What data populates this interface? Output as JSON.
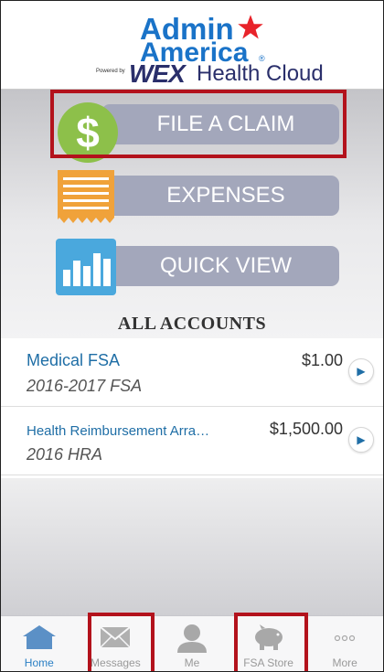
{
  "logo": {
    "line1": "Admin",
    "line2": "America",
    "registered": "®",
    "powered_by": "Powered by",
    "brand": "WEX",
    "brand_suffix": "Health Cloud",
    "star_color": "#e8232a"
  },
  "actions": [
    {
      "label": "FILE A CLAIM",
      "icon": "dollar-icon",
      "glyph": "$"
    },
    {
      "label": "EXPENSES",
      "icon": "receipt-icon"
    },
    {
      "label": "QUICK VIEW",
      "icon": "bar-chart-icon"
    }
  ],
  "section_title": "ALL ACCOUNTS",
  "accounts": [
    {
      "name": "Medical FSA",
      "amount": "$1.00",
      "plan": "2016-2017 FSA"
    },
    {
      "name": "Health Reimbursement Arra…",
      "amount": "$1,500.00",
      "plan": "2016 HRA"
    }
  ],
  "tabs": [
    {
      "label": "Home",
      "icon": "home-icon",
      "active": true
    },
    {
      "label": "Messages",
      "icon": "envelope-icon",
      "active": false
    },
    {
      "label": "Me",
      "icon": "person-icon",
      "active": false
    },
    {
      "label": "FSA Store",
      "icon": "piggy-bank-icon",
      "active": false
    },
    {
      "label": "More",
      "icon": "more-dots-icon",
      "active": false
    }
  ],
  "colors": {
    "brand_blue": "#1a73c8",
    "button_bg": "#a3a7bb",
    "highlight": "#b3121c",
    "active_tab": "#2a7fc4"
  }
}
